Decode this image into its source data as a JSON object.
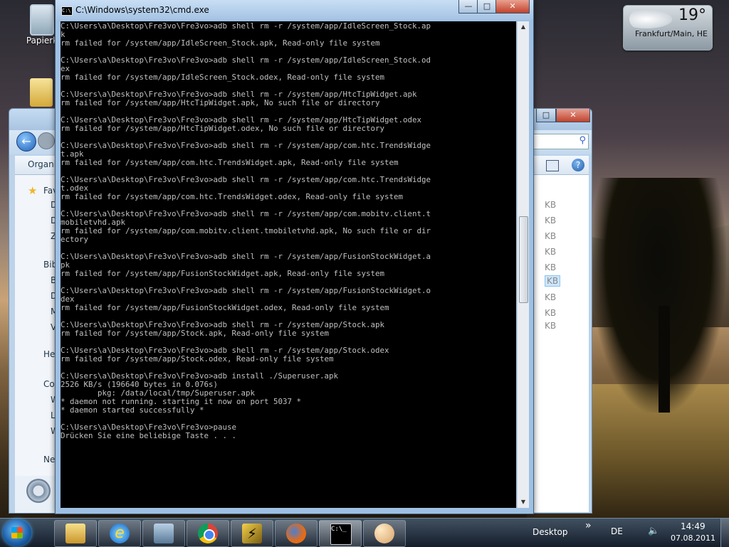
{
  "desktop": {
    "icons": [
      {
        "label": "Papierk"
      }
    ]
  },
  "weather": {
    "temperature": "19°",
    "location": "Frankfurt/Main, HE"
  },
  "explorer": {
    "organize_label": "Organi",
    "nav_items": [
      "Fav",
      "D",
      "D",
      "Z",
      "Bibl",
      "B",
      "D",
      "M",
      "V",
      "He",
      "Co",
      "W",
      "L",
      "W",
      "Ne"
    ],
    "sizes": [
      "KB",
      "KB",
      "KB",
      "KB",
      "KB",
      "KB",
      "KB",
      "KB",
      "KB"
    ],
    "maximize_glyph": "□",
    "close_glyph": "✕"
  },
  "cmd": {
    "title": "C:\\Windows\\system32\\cmd.exe",
    "icon_glyph": "C:\\",
    "minimize_glyph": "—",
    "maximize_glyph": "□",
    "close_glyph": "✕",
    "scroll_up": "▲",
    "scroll_down": "▼",
    "output": "C:\\Users\\a\\Desktop\\Fre3vo\\Fre3vo>adb shell rm -r /system/app/IdleScreen_Stock.ap\nk\nrm failed for /system/app/IdleScreen_Stock.apk, Read-only file system\n\nC:\\Users\\a\\Desktop\\Fre3vo\\Fre3vo>adb shell rm -r /system/app/IdleScreen_Stock.od\nex\nrm failed for /system/app/IdleScreen_Stock.odex, Read-only file system\n\nC:\\Users\\a\\Desktop\\Fre3vo\\Fre3vo>adb shell rm -r /system/app/HtcTipWidget.apk\nrm failed for /system/app/HtcTipWidget.apk, No such file or directory\n\nC:\\Users\\a\\Desktop\\Fre3vo\\Fre3vo>adb shell rm -r /system/app/HtcTipWidget.odex\nrm failed for /system/app/HtcTipWidget.odex, No such file or directory\n\nC:\\Users\\a\\Desktop\\Fre3vo\\Fre3vo>adb shell rm -r /system/app/com.htc.TrendsWidge\nt.apk\nrm failed for /system/app/com.htc.TrendsWidget.apk, Read-only file system\n\nC:\\Users\\a\\Desktop\\Fre3vo\\Fre3vo>adb shell rm -r /system/app/com.htc.TrendsWidge\nt.odex\nrm failed for /system/app/com.htc.TrendsWidget.odex, Read-only file system\n\nC:\\Users\\a\\Desktop\\Fre3vo\\Fre3vo>adb shell rm -r /system/app/com.mobitv.client.t\nmobiletvhd.apk\nrm failed for /system/app/com.mobitv.client.tmobiletvhd.apk, No such file or dir\nectory\n\nC:\\Users\\a\\Desktop\\Fre3vo\\Fre3vo>adb shell rm -r /system/app/FusionStockWidget.a\npk\nrm failed for /system/app/FusionStockWidget.apk, Read-only file system\n\nC:\\Users\\a\\Desktop\\Fre3vo\\Fre3vo>adb shell rm -r /system/app/FusionStockWidget.o\ndex\nrm failed for /system/app/FusionStockWidget.odex, Read-only file system\n\nC:\\Users\\a\\Desktop\\Fre3vo\\Fre3vo>adb shell rm -r /system/app/Stock.apk\nrm failed for /system/app/Stock.apk, Read-only file system\n\nC:\\Users\\a\\Desktop\\Fre3vo\\Fre3vo>adb shell rm -r /system/app/Stock.odex\nrm failed for /system/app/Stock.odex, Read-only file system\n\nC:\\Users\\a\\Desktop\\Fre3vo\\Fre3vo>adb install ./Superuser.apk\n2526 KB/s (196640 bytes in 0.076s)\n        pkg: /data/local/tmp/Superuser.apk\n* daemon not running. starting it now on port 5037 *\n* daemon started successfully *\n\nC:\\Users\\a\\Desktop\\Fre3vo\\Fre3vo>pause\nDrücken Sie eine beliebige Taste . . ."
  },
  "taskbar": {
    "ie_glyph": "e",
    "cmd_glyph": "C:\\_",
    "desktop_label": "Desktop",
    "chevron": "»",
    "language": "DE",
    "volume_glyph": "🔈",
    "time": "14:49",
    "date": "07.08.2011"
  }
}
